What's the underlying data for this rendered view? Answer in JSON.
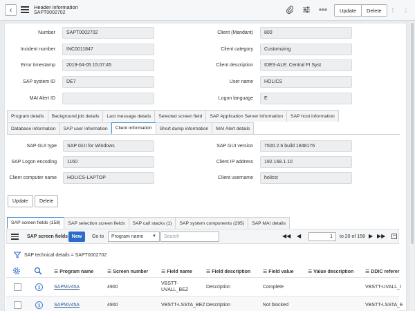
{
  "header": {
    "title": "Header information",
    "subtitle": "SAPT0002702",
    "update_label": "Update",
    "delete_label": "Delete"
  },
  "form": {
    "left": [
      {
        "label": "Number",
        "value": "SAPT0002702"
      },
      {
        "label": "Incident number",
        "value": "INC0011847"
      },
      {
        "label": "Error timestamp",
        "value": "2019-04-05 15:07:45"
      },
      {
        "label": "SAP system ID",
        "value": "DE7"
      },
      {
        "label": "MAI Alert ID",
        "value": ""
      }
    ],
    "right": [
      {
        "label": "Client (Mandant)",
        "value": "800"
      },
      {
        "label": "Client category",
        "value": "Customizing"
      },
      {
        "label": "Client description",
        "value": "IDES-ALE: Central FI Syst"
      },
      {
        "label": "User name",
        "value": "HOLICS"
      },
      {
        "label": "Logon language",
        "value": "E"
      }
    ]
  },
  "tabs_row1": [
    "Program details",
    "Background job details",
    "Last message details",
    "Selected screen field",
    "SAP Application Server information",
    "SAP host information"
  ],
  "tabs_row2": [
    "Database information",
    "SAP user information",
    "Client information",
    "Short dump information",
    "MAI Alert details"
  ],
  "client_info": {
    "left": [
      {
        "label": "SAP GUI type",
        "value": "SAP GUI for Windows"
      },
      {
        "label": "SAP Logon encoding",
        "value": "1160"
      },
      {
        "label": "Client computer name",
        "value": "HOLICS-LAPTOP"
      }
    ],
    "right": [
      {
        "label": "SAP GUI version",
        "value": "7500.2.6 build 1848176"
      },
      {
        "label": "Client IP address",
        "value": "192.168.1.10"
      },
      {
        "label": "Client username",
        "value": "holicst"
      }
    ]
  },
  "form_buttons": {
    "update_label": "Update",
    "delete_label": "Delete"
  },
  "related_tabs": [
    "SAP screen fields (158)",
    "SAP selection screen fields",
    "SAP call stacks (1)",
    "SAP system components (295)",
    "SAP MAI details"
  ],
  "list": {
    "title": "SAP screen fields",
    "new_label": "New",
    "goto_label": "Go to",
    "goto_field": "Program name",
    "search_placeholder": "Search",
    "page_value": "1",
    "page_range": "to 20 of 158",
    "filter_text": "SAP technical details = SAPT0002702",
    "columns": [
      "Program name",
      "Screen number",
      "Field name",
      "Field description",
      "Field value",
      "Value description",
      "DDIC referer"
    ],
    "rows": [
      {
        "program": "SAPMV45A",
        "screen": "4900",
        "field_line1": "VBSTT-",
        "field_line2": "UVALL_BEZ",
        "description": "Description",
        "value": "Complete",
        "value_desc": "",
        "ddic": "VBSTT-UVALL_I"
      },
      {
        "program": "SAPMV45A",
        "screen": "4900",
        "field_line1": "VBSTT-LSSTA_BEZ",
        "field_line2": "",
        "description": "Description",
        "value": "Not blocked",
        "value_desc": "",
        "ddic": "VBSTT-LSSTA_E"
      }
    ]
  }
}
